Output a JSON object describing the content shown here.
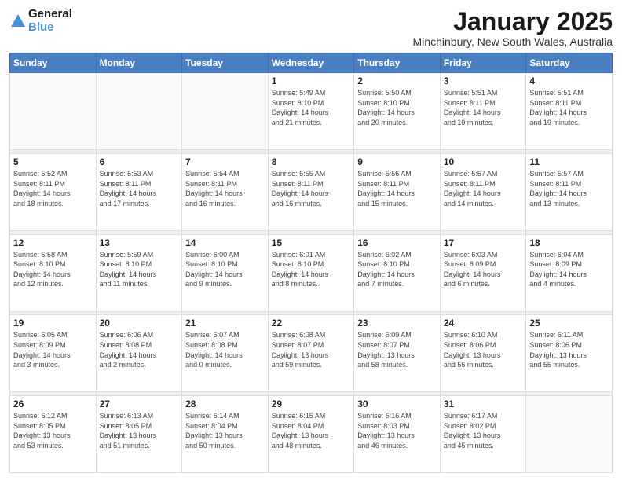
{
  "logo": {
    "line1": "General",
    "line2": "Blue"
  },
  "header": {
    "title": "January 2025",
    "subtitle": "Minchinbury, New South Wales, Australia"
  },
  "weekdays": [
    "Sunday",
    "Monday",
    "Tuesday",
    "Wednesday",
    "Thursday",
    "Friday",
    "Saturday"
  ],
  "weeks": [
    [
      {
        "day": "",
        "info": ""
      },
      {
        "day": "",
        "info": ""
      },
      {
        "day": "",
        "info": ""
      },
      {
        "day": "1",
        "info": "Sunrise: 5:49 AM\nSunset: 8:10 PM\nDaylight: 14 hours\nand 21 minutes."
      },
      {
        "day": "2",
        "info": "Sunrise: 5:50 AM\nSunset: 8:10 PM\nDaylight: 14 hours\nand 20 minutes."
      },
      {
        "day": "3",
        "info": "Sunrise: 5:51 AM\nSunset: 8:11 PM\nDaylight: 14 hours\nand 19 minutes."
      },
      {
        "day": "4",
        "info": "Sunrise: 5:51 AM\nSunset: 8:11 PM\nDaylight: 14 hours\nand 19 minutes."
      }
    ],
    [
      {
        "day": "5",
        "info": "Sunrise: 5:52 AM\nSunset: 8:11 PM\nDaylight: 14 hours\nand 18 minutes."
      },
      {
        "day": "6",
        "info": "Sunrise: 5:53 AM\nSunset: 8:11 PM\nDaylight: 14 hours\nand 17 minutes."
      },
      {
        "day": "7",
        "info": "Sunrise: 5:54 AM\nSunset: 8:11 PM\nDaylight: 14 hours\nand 16 minutes."
      },
      {
        "day": "8",
        "info": "Sunrise: 5:55 AM\nSunset: 8:11 PM\nDaylight: 14 hours\nand 16 minutes."
      },
      {
        "day": "9",
        "info": "Sunrise: 5:56 AM\nSunset: 8:11 PM\nDaylight: 14 hours\nand 15 minutes."
      },
      {
        "day": "10",
        "info": "Sunrise: 5:57 AM\nSunset: 8:11 PM\nDaylight: 14 hours\nand 14 minutes."
      },
      {
        "day": "11",
        "info": "Sunrise: 5:57 AM\nSunset: 8:11 PM\nDaylight: 14 hours\nand 13 minutes."
      }
    ],
    [
      {
        "day": "12",
        "info": "Sunrise: 5:58 AM\nSunset: 8:10 PM\nDaylight: 14 hours\nand 12 minutes."
      },
      {
        "day": "13",
        "info": "Sunrise: 5:59 AM\nSunset: 8:10 PM\nDaylight: 14 hours\nand 11 minutes."
      },
      {
        "day": "14",
        "info": "Sunrise: 6:00 AM\nSunset: 8:10 PM\nDaylight: 14 hours\nand 9 minutes."
      },
      {
        "day": "15",
        "info": "Sunrise: 6:01 AM\nSunset: 8:10 PM\nDaylight: 14 hours\nand 8 minutes."
      },
      {
        "day": "16",
        "info": "Sunrise: 6:02 AM\nSunset: 8:10 PM\nDaylight: 14 hours\nand 7 minutes."
      },
      {
        "day": "17",
        "info": "Sunrise: 6:03 AM\nSunset: 8:09 PM\nDaylight: 14 hours\nand 6 minutes."
      },
      {
        "day": "18",
        "info": "Sunrise: 6:04 AM\nSunset: 8:09 PM\nDaylight: 14 hours\nand 4 minutes."
      }
    ],
    [
      {
        "day": "19",
        "info": "Sunrise: 6:05 AM\nSunset: 8:09 PM\nDaylight: 14 hours\nand 3 minutes."
      },
      {
        "day": "20",
        "info": "Sunrise: 6:06 AM\nSunset: 8:08 PM\nDaylight: 14 hours\nand 2 minutes."
      },
      {
        "day": "21",
        "info": "Sunrise: 6:07 AM\nSunset: 8:08 PM\nDaylight: 14 hours\nand 0 minutes."
      },
      {
        "day": "22",
        "info": "Sunrise: 6:08 AM\nSunset: 8:07 PM\nDaylight: 13 hours\nand 59 minutes."
      },
      {
        "day": "23",
        "info": "Sunrise: 6:09 AM\nSunset: 8:07 PM\nDaylight: 13 hours\nand 58 minutes."
      },
      {
        "day": "24",
        "info": "Sunrise: 6:10 AM\nSunset: 8:06 PM\nDaylight: 13 hours\nand 56 minutes."
      },
      {
        "day": "25",
        "info": "Sunrise: 6:11 AM\nSunset: 8:06 PM\nDaylight: 13 hours\nand 55 minutes."
      }
    ],
    [
      {
        "day": "26",
        "info": "Sunrise: 6:12 AM\nSunset: 8:05 PM\nDaylight: 13 hours\nand 53 minutes."
      },
      {
        "day": "27",
        "info": "Sunrise: 6:13 AM\nSunset: 8:05 PM\nDaylight: 13 hours\nand 51 minutes."
      },
      {
        "day": "28",
        "info": "Sunrise: 6:14 AM\nSunset: 8:04 PM\nDaylight: 13 hours\nand 50 minutes."
      },
      {
        "day": "29",
        "info": "Sunrise: 6:15 AM\nSunset: 8:04 PM\nDaylight: 13 hours\nand 48 minutes."
      },
      {
        "day": "30",
        "info": "Sunrise: 6:16 AM\nSunset: 8:03 PM\nDaylight: 13 hours\nand 46 minutes."
      },
      {
        "day": "31",
        "info": "Sunrise: 6:17 AM\nSunset: 8:02 PM\nDaylight: 13 hours\nand 45 minutes."
      },
      {
        "day": "",
        "info": ""
      }
    ]
  ]
}
